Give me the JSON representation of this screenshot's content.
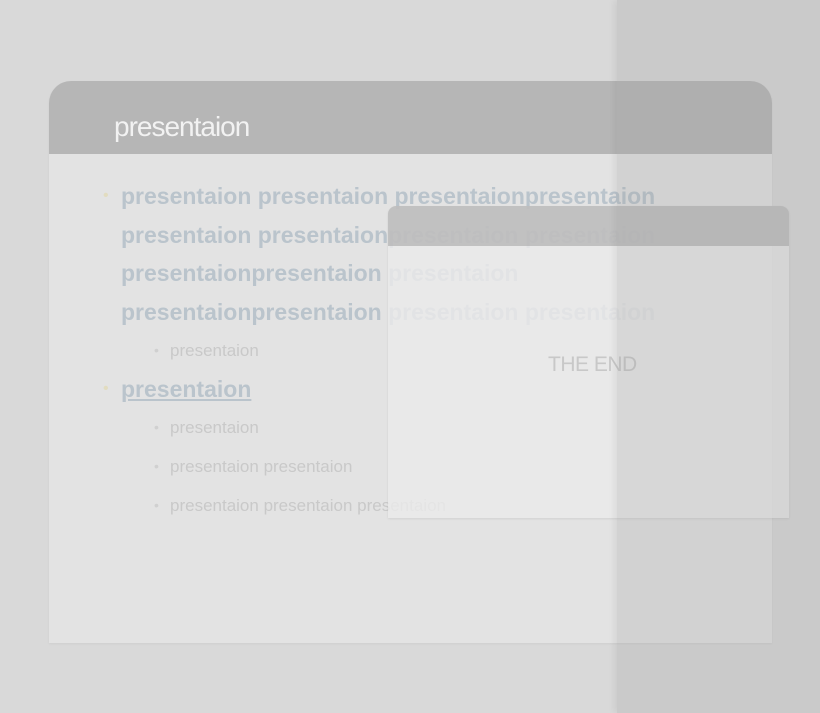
{
  "slide": {
    "title": "presentaion",
    "bullets": [
      {
        "lines": [
          "presentaion presentaion presentaionpresentaion",
          "presentaion presentaionpresentaion presentaion",
          "presentaionpresentaion presentaion",
          "presentaionpresentaion presentaion presentaion"
        ]
      },
      {
        "lines": [
          "presentaion"
        ],
        "underlined": true
      }
    ],
    "sub_bullets": [
      "presentaion",
      "presentaion",
      "presentaion presentaion",
      "presentaion presentaion presentaion"
    ]
  },
  "card": {
    "text": "THE END"
  },
  "colors": {
    "background": "#d9d9d9",
    "slide_body": "#e3e3e3",
    "slide_header": "#b6b6b6",
    "bullet_text": "#bac4cc",
    "sub_bullet_text": "#c9c9c9",
    "bullet_dot": "#e2dcc0"
  }
}
